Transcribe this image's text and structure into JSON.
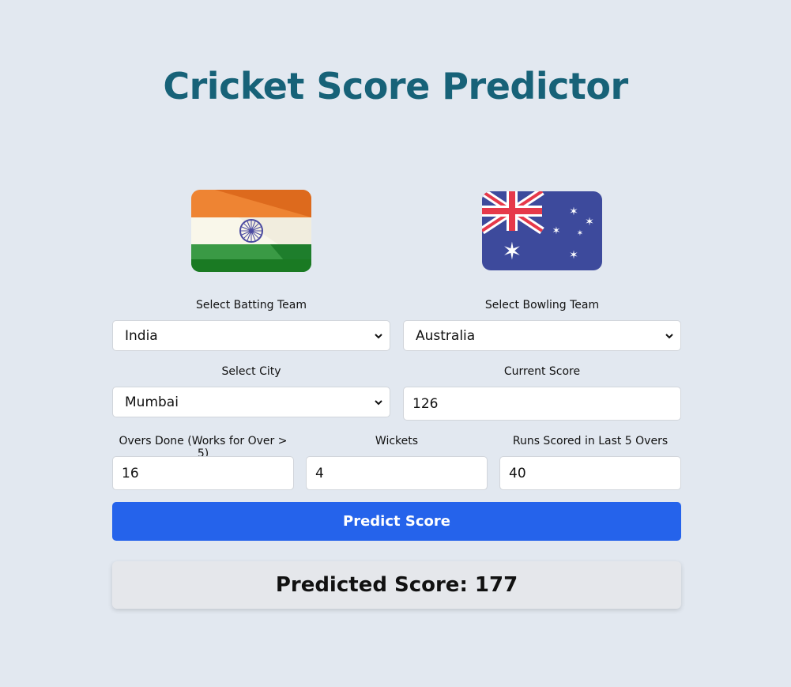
{
  "header": {
    "title": "Cricket Score Predictor"
  },
  "flags": {
    "batting": "india-flag-icon",
    "bowling": "australia-flag-icon"
  },
  "form": {
    "batting_team_label": "Select Batting Team",
    "batting_team_value": "India",
    "bowling_team_label": "Select Bowling Team",
    "bowling_team_value": "Australia",
    "city_label": "Select City",
    "city_value": "Mumbai",
    "current_score_label": "Current Score",
    "current_score_value": "126",
    "overs_label": "Overs Done (Works for Over > 5)",
    "overs_value": "16",
    "wickets_label": "Wickets",
    "wickets_value": "4",
    "last5_label": "Runs Scored in Last 5 Overs",
    "last5_value": "40",
    "predict_button": "Predict Score"
  },
  "result": {
    "text": "Predicted Score: 177"
  },
  "colors": {
    "background": "#e2e8f0",
    "title": "#176278",
    "button": "#2563eb",
    "result_card": "#e5e7eb"
  }
}
